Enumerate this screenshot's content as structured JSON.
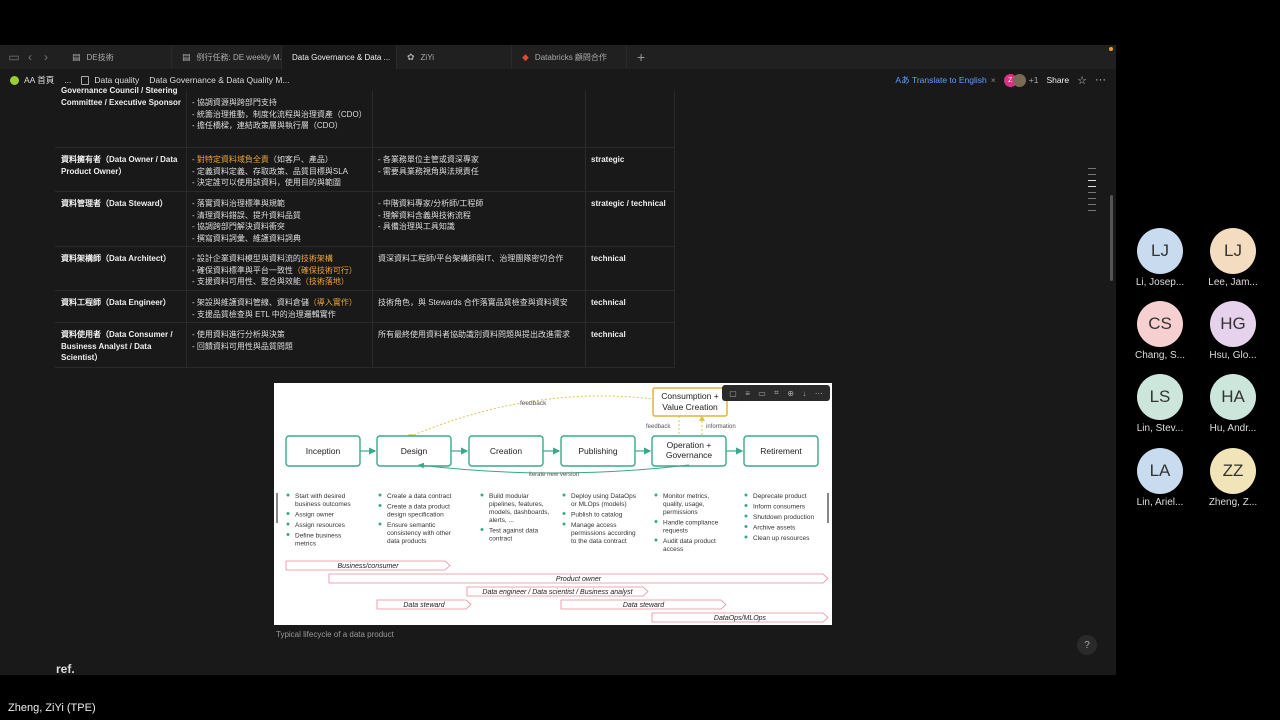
{
  "tabs": [
    {
      "icon": "doc-icon",
      "label": "DE技術",
      "active": false
    },
    {
      "icon": "doc-icon",
      "label": "例行任務: DE weekly M...",
      "active": false
    },
    {
      "icon": "doc-icon",
      "label": "Data Governance & Data ...",
      "active": true
    },
    {
      "icon": "leaf-icon",
      "label": "ZiYi",
      "active": false
    },
    {
      "icon": "databricks-icon",
      "label": "Databricks 顧問合作",
      "active": false
    }
  ],
  "breadcrumb": {
    "workspace": "AA 首頁",
    "ellipsis": "...",
    "parent": "Data quality",
    "current": "Data Governance & Data Quality M..."
  },
  "actions": {
    "translate": "Translate to English",
    "avatar_initial": "Z",
    "extra_count": "+1",
    "share": "Share"
  },
  "table_rows": [
    {
      "role": "Governance Council / Steering Committee / Executive Sponsor",
      "responsibilities": [
        "- 協調資源與跨部門支持",
        "- 統籌治理推動，制度化流程與治理資產（CDO）",
        "- 擔任橋樑，連結政策層與執行層（CDO）"
      ],
      "members": "",
      "level": ""
    },
    {
      "role": "資料擁有者（Data Owner / Data Product Owner）",
      "resp_hl_prefix": "- ",
      "resp_hl": "對特定資料域負全責",
      "resp_hl_suffix": "（如客戶、產品）",
      "responsibilities": [
        "- 定義資料定義、存取政策、品質目標與SLA",
        "- 決定誰可以使用該資料，使用目的與範圍"
      ],
      "members": "- 各業務單位主管或資深專家\n- 需要具業務視角與法規責任",
      "level": "strategic"
    },
    {
      "role": "資料管理者（Data Steward）",
      "responsibilities": [
        "- 落實資料治理標準與規範",
        "- 清理資料錯誤、提升資料品質",
        "- 協調跨部門解決資料衝突",
        "- 撰寫資料詞彙、維護資料詞典"
      ],
      "members": "- 中階資料專家/分析師/工程師\n- 理解資料含義與技術流程\n- 具備治理與工具知識",
      "level": "strategic / technical"
    },
    {
      "role": "資料架構師（Data Architect）",
      "resp_line1": "- 設計企業資料模型與資料流的",
      "resp_line1_hl": "技術架構",
      "resp_line2": "- 確保資料標準與平台一致性",
      "resp_line2_hl": "（確保技術可行）",
      "resp_line3": "- 支援資料可用性、整合與效能",
      "resp_line3_hl": "（技術落地）",
      "members": "資深資料工程師/平台架構師與IT、治理團隊密切合作",
      "level": "technical"
    },
    {
      "role": "資料工程師（Data Engineer）",
      "resp_line1": "- 架設與維護資料管線、資料倉儲",
      "resp_line1_hl": "（導入實作）",
      "resp_line2": "- 支援品質檢查與 ETL 中的治理邏輯實作",
      "members": "技術角色，與 Stewards 合作落實品質檢查與資料資安",
      "level": "technical"
    },
    {
      "role": "資料使用者（Data Consumer / Business Analyst / Data Scientist）",
      "responsibilities": [
        "- 使用資料進行分析與決策",
        "- 回饋資料可用性與品質問題"
      ],
      "members": "所有最終使用資料者協助識別資料問題與提出改進需求",
      "level": "technical"
    }
  ],
  "lifecycle": {
    "stages": [
      "Inception",
      "Design",
      "Creation",
      "Publishing",
      "Operation + Governance",
      "Retirement"
    ],
    "consumption": "Consumption + Value Creation",
    "feedback_top": "feedback",
    "feedback_side": "feedback",
    "information": "information",
    "iterate": "iterate new version",
    "bullets": [
      [
        "Start with desired business outcomes",
        "Assign owner",
        "Assign resources",
        "Define business metrics"
      ],
      [
        "Create a data contract",
        "Create a data product design specification",
        "Ensure semantic consistency with other data products"
      ],
      [
        "Build modular pipelines, features, models, dashboards, alerts, ...",
        "Test against data contract"
      ],
      [
        "Deploy using DataOps or MLOps (models)",
        "Publish to catalog",
        "Manage access permissions according to the data contract"
      ],
      [
        "Monitor metrics, quality, usage, permissions",
        "Handle compliance requests",
        "Audit data product access"
      ],
      [
        "Deprecate product",
        "Inform consumers",
        "Shutdown production",
        "Archive assets",
        "Clean up resources"
      ]
    ],
    "roles": [
      "Business/consumer",
      "Product owner",
      "Data engineer / Data scientist / Business analyst",
      "Data steward",
      "Data steward",
      "DataOps/MLOps"
    ],
    "caption": "Typical lifecycle of a data product"
  },
  "ref_heading": "ref.",
  "help": "?",
  "participants": [
    {
      "initials": "LJ",
      "name": "Li, Josep...",
      "color": "#c9dcef"
    },
    {
      "initials": "LJ",
      "name": "Lee, Jam...",
      "color": "#f3dcc0"
    },
    {
      "initials": "CS",
      "name": "Chang, S...",
      "color": "#f6d0d0"
    },
    {
      "initials": "HG",
      "name": "Hsu, Glo...",
      "color": "#e6d2ec"
    },
    {
      "initials": "LS",
      "name": "Lin, Stev...",
      "color": "#cde6dc"
    },
    {
      "initials": "HA",
      "name": "Hu, Andr...",
      "color": "#cde6dc"
    },
    {
      "initials": "LA",
      "name": "Lin, Ariel...",
      "color": "#c9dcef"
    },
    {
      "initials": "ZZ",
      "name": "Zheng, Z...",
      "color": "#f0e4b8"
    }
  ],
  "current_user": "Zheng, ZiYi (TPE)"
}
